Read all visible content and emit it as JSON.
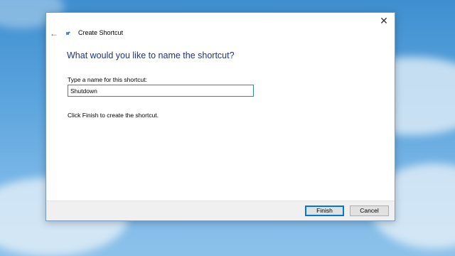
{
  "dialog": {
    "title": "Create Shortcut",
    "close_glyph": "✕",
    "back_glyph": "←",
    "heading": "What would you like to name the shortcut?",
    "field_label": "Type a name for this shortcut:",
    "name_value": "Shutdown",
    "hint": "Click Finish to create the shortcut.",
    "finish_label": "Finish",
    "cancel_label": "Cancel"
  },
  "icons": {
    "close": "close-icon",
    "back": "back-arrow-icon",
    "wizard": "shortcut-wizard-icon"
  },
  "colors": {
    "heading": "#1e3287",
    "input_border": "#3b7bd0",
    "primary_border": "#0078d7",
    "desktop_sky": "#58a2dc"
  }
}
